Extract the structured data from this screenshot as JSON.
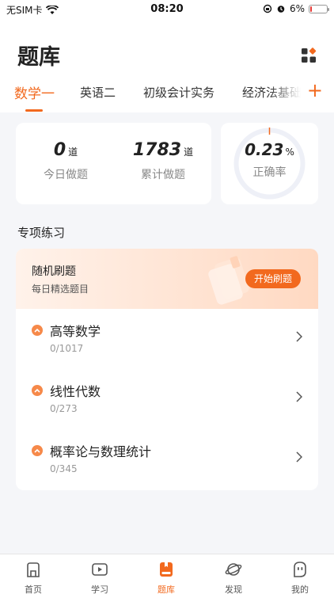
{
  "status_bar": {
    "carrier": "无SIM卡",
    "time": "08:20",
    "battery": "6%"
  },
  "header": {
    "title": "题库"
  },
  "tabs": [
    {
      "label": "数学一",
      "active": true
    },
    {
      "label": "英语二"
    },
    {
      "label": "初级会计实务"
    },
    {
      "label": "经济法基础"
    }
  ],
  "stats": {
    "today": {
      "value": "0",
      "unit": "道",
      "label": "今日做题"
    },
    "total": {
      "value": "1783",
      "unit": "道",
      "label": "累计做题"
    },
    "accuracy": {
      "value": "0.23",
      "unit": "%",
      "label": "正确率"
    }
  },
  "section": {
    "title": "专项练习"
  },
  "banner": {
    "title": "随机刷题",
    "subtitle": "每日精选题目",
    "button": "开始刷题"
  },
  "subjects": [
    {
      "name": "高等数学",
      "progress": "0/1017"
    },
    {
      "name": "线性代数",
      "progress": "0/273"
    },
    {
      "name": "概率论与数理统计",
      "progress": "0/345"
    }
  ],
  "nav": [
    {
      "label": "首页",
      "icon": "home-icon"
    },
    {
      "label": "学习",
      "icon": "play-icon"
    },
    {
      "label": "题库",
      "icon": "book-icon",
      "active": true
    },
    {
      "label": "发现",
      "icon": "planet-icon"
    },
    {
      "label": "我的",
      "icon": "profile-icon"
    }
  ],
  "colors": {
    "accent": "#f2691e",
    "background": "#f5f6f9"
  }
}
